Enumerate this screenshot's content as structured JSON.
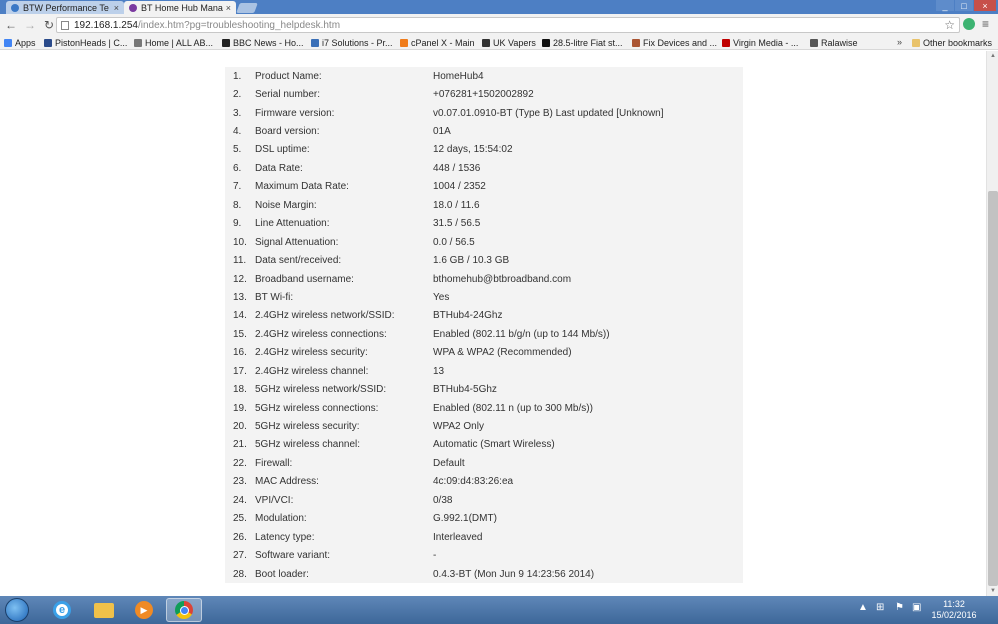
{
  "browser": {
    "tabs": [
      {
        "label": "BTW Performance Te",
        "active": false
      },
      {
        "label": "BT Home Hub Manag",
        "active": true
      }
    ],
    "url": {
      "host": "192.168.1.254",
      "path": "/index.htm?pg=troubleshooting_helpdesk.htm"
    },
    "bookmarks": [
      {
        "label": "Apps",
        "color": "#4285f4"
      },
      {
        "label": "PistonHeads | C...",
        "color": "#2a4a8a"
      },
      {
        "label": "Home | ALL AB...",
        "color": "#777777"
      },
      {
        "label": "BBC News - Ho...",
        "color": "#222222"
      },
      {
        "label": "i7 Solutions - Pr...",
        "color": "#3a6fb7"
      },
      {
        "label": "cPanel X - Main",
        "color": "#f07c1b"
      },
      {
        "label": "UK Vapers",
        "color": "#333333"
      },
      {
        "label": "28.5-litre Fiat st...",
        "color": "#111111"
      },
      {
        "label": "Fix Devices and ...",
        "color": "#aa5533"
      },
      {
        "label": "Virgin Media - ...",
        "color": "#c00000"
      },
      {
        "label": "Ralawise",
        "color": "#555555"
      }
    ],
    "bookmarks_more": "»",
    "other_bookmarks": "Other bookmarks"
  },
  "helpdesk": {
    "rows": [
      {
        "num": "1.",
        "label": "Product Name:",
        "value": "HomeHub4"
      },
      {
        "num": "2.",
        "label": "Serial number:",
        "value": "+076281+1502002892"
      },
      {
        "num": "3.",
        "label": "Firmware version:",
        "value": "v0.07.01.0910-BT (Type B) Last updated [Unknown]"
      },
      {
        "num": "4.",
        "label": "Board version:",
        "value": "01A"
      },
      {
        "num": "5.",
        "label": "DSL uptime:",
        "value": "12 days, 15:54:02"
      },
      {
        "num": "6.",
        "label": "Data Rate:",
        "value": "448 / 1536"
      },
      {
        "num": "7.",
        "label": "Maximum Data Rate:",
        "value": "1004 / 2352"
      },
      {
        "num": "8.",
        "label": "Noise Margin:",
        "value": "18.0 / 11.6"
      },
      {
        "num": "9.",
        "label": "Line Attenuation:",
        "value": "31.5 / 56.5"
      },
      {
        "num": "10.",
        "label": "Signal Attenuation:",
        "value": "0.0 / 56.5"
      },
      {
        "num": "11.",
        "label": "Data sent/received:",
        "value": "1.6 GB / 10.3 GB"
      },
      {
        "num": "12.",
        "label": "Broadband username:",
        "value": "bthomehub@btbroadband.com"
      },
      {
        "num": "13.",
        "label": "BT Wi-fi:",
        "value": "Yes"
      },
      {
        "num": "14.",
        "label": "2.4GHz wireless network/SSID:",
        "value": "BTHub4-24Ghz"
      },
      {
        "num": "15.",
        "label": "2.4GHz wireless connections:",
        "value": "Enabled (802.11 b/g/n (up to 144 Mb/s))"
      },
      {
        "num": "16.",
        "label": "2.4GHz wireless security:",
        "value": "WPA & WPA2 (Recommended)"
      },
      {
        "num": "17.",
        "label": "2.4GHz wireless channel:",
        "value": "13"
      },
      {
        "num": "18.",
        "label": "5GHz wireless network/SSID:",
        "value": "BTHub4-5Ghz"
      },
      {
        "num": "19.",
        "label": "5GHz wireless connections:",
        "value": "Enabled (802.11 n (up to 300 Mb/s))"
      },
      {
        "num": "20.",
        "label": "5GHz wireless security:",
        "value": "WPA2 Only"
      },
      {
        "num": "21.",
        "label": "5GHz wireless channel:",
        "value": "Automatic (Smart Wireless)"
      },
      {
        "num": "22.",
        "label": "Firewall:",
        "value": "Default"
      },
      {
        "num": "23.",
        "label": "MAC Address:",
        "value": "4c:09:d4:83:26:ea"
      },
      {
        "num": "24.",
        "label": "VPI/VCI:",
        "value": "0/38"
      },
      {
        "num": "25.",
        "label": "Modulation:",
        "value": "G.992.1(DMT)"
      },
      {
        "num": "26.",
        "label": "Latency type:",
        "value": "Interleaved"
      },
      {
        "num": "27.",
        "label": "Software variant:",
        "value": "-"
      },
      {
        "num": "28.",
        "label": "Boot loader:",
        "value": "0.4.3-BT (Mon Jun 9 14:23:56 2014)"
      }
    ]
  },
  "taskbar": {
    "time": "11:32",
    "date": "15/02/2016"
  },
  "icons": {
    "back": "←",
    "forward": "→",
    "reload": "↻",
    "star": "☆",
    "menu": "≡",
    "close": "×",
    "minimize": "_",
    "maximize": "□",
    "tray_up": "▲"
  }
}
